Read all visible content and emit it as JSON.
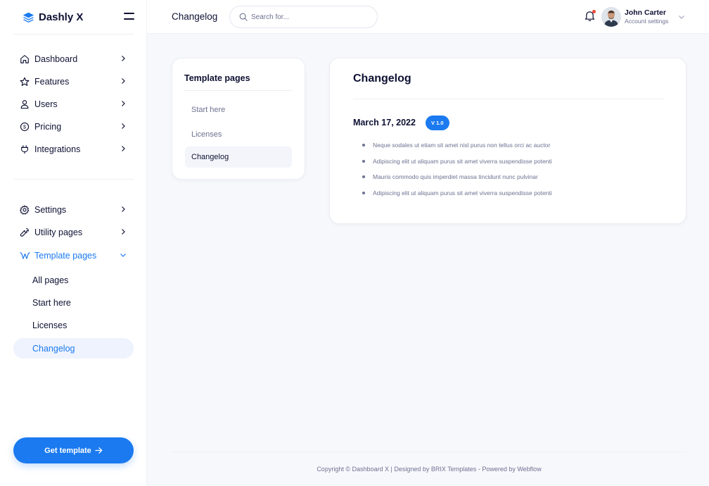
{
  "app": {
    "brand": "Dashly X"
  },
  "sidebar": {
    "items": [
      {
        "label": "Dashboard",
        "icon": "home-icon"
      },
      {
        "label": "Features",
        "icon": "star-icon"
      },
      {
        "label": "Users",
        "icon": "user-icon"
      },
      {
        "label": "Pricing",
        "icon": "dollar-icon"
      },
      {
        "label": "Integrations",
        "icon": "plug-icon"
      }
    ],
    "items2": [
      {
        "label": "Settings",
        "icon": "gear-icon"
      },
      {
        "label": "Utility pages",
        "icon": "wrench-icon"
      },
      {
        "label": "Template pages",
        "icon": "w-logo-icon",
        "active": true
      }
    ],
    "sub_items": [
      {
        "label": "All pages"
      },
      {
        "label": "Start here"
      },
      {
        "label": "Licenses"
      },
      {
        "label": "Changelog",
        "active": true
      }
    ],
    "cta_label": "Get template"
  },
  "header": {
    "title": "Changelog",
    "search_placeholder": "Search for...",
    "user_name": "John Carter",
    "user_subtitle": "Account settings"
  },
  "template_nav": {
    "title": "Template pages",
    "links": [
      {
        "label": "Start here"
      },
      {
        "label": "Licenses"
      },
      {
        "label": "Changelog",
        "active": true
      }
    ]
  },
  "changelog": {
    "title": "Changelog",
    "date": "March 17, 2022",
    "version": "V 1.0",
    "changes": [
      "Neque sodales ut etiam sit amet nisl purus non tellus orci ac auctor",
      "Adipiscing elit ut aliquam purus sit amet viverra suspendisse potenti",
      "Mauris commodo quis imperdiet massa tincidunt nunc pulvinar",
      "Adipiscing elit ut aliquam purus sit amet viverra suspendisse potenti"
    ]
  },
  "footer": {
    "copyright": "Copyright © Dashboard X",
    "separator": "|",
    "designed": "Designed by BRIX Templates",
    "dash": "-",
    "powered": "Powered by Webflow"
  },
  "colors": {
    "accent": "#1b7af0",
    "text": "#0e1133",
    "muted": "#6e7191",
    "notification": "#f0483e"
  }
}
